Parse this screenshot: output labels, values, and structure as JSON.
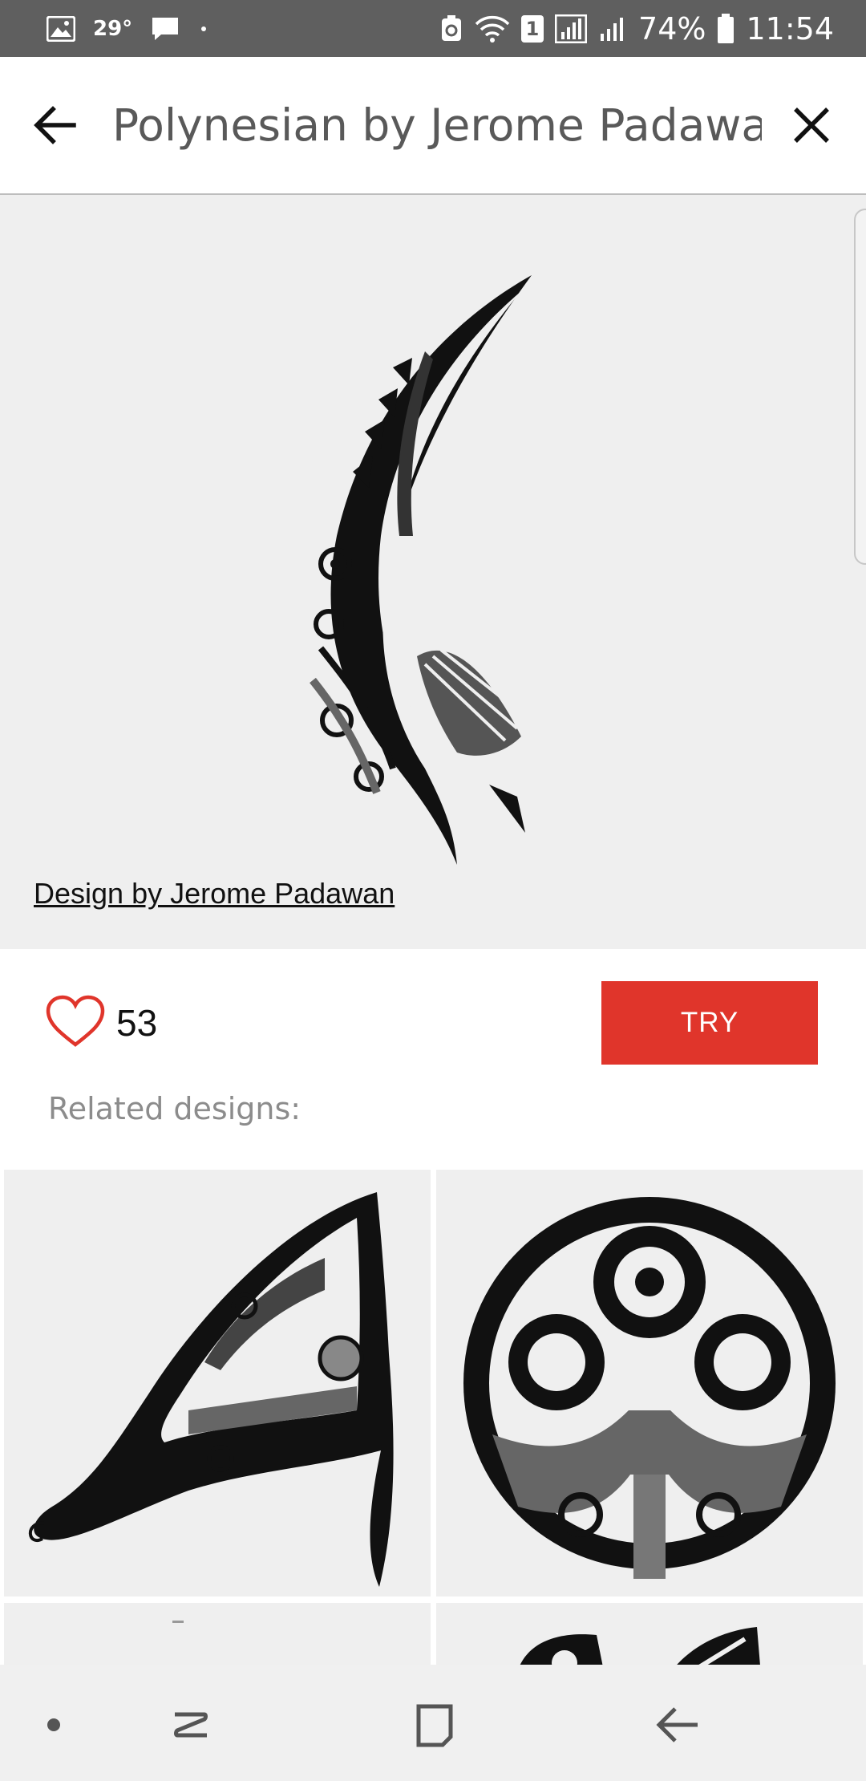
{
  "status_bar": {
    "temperature": "29°",
    "sim_badge": "1",
    "battery_percent": "74%",
    "time": "11:54",
    "icons": [
      "gallery-icon",
      "chat-icon",
      "dot-icon",
      "recycle-icon",
      "wifi-icon",
      "signal-icon",
      "battery-icon"
    ]
  },
  "app_bar": {
    "title": "Polynesian by Jerome Padawan",
    "back_icon": "arrow-left-icon",
    "close_icon": "close-icon"
  },
  "hero": {
    "design_credit": "Design by Jerome Padawan"
  },
  "actions": {
    "like_count": "53",
    "try_label": "TRY",
    "accent_color": "#e0352b"
  },
  "related": {
    "label": "Related designs:"
  },
  "nav_bar": {
    "icons": [
      "dot-icon",
      "recents-icon",
      "home-icon",
      "back-icon"
    ]
  }
}
